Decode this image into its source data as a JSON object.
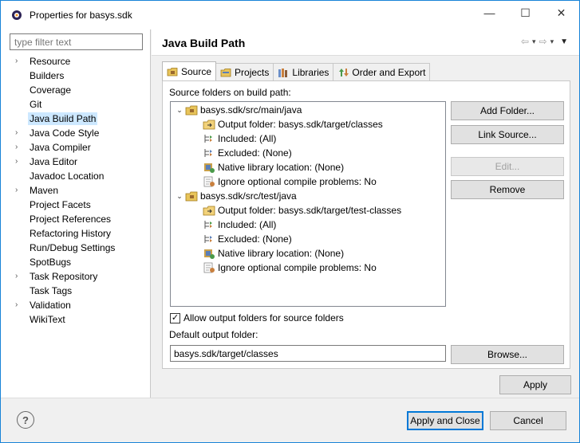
{
  "window": {
    "title": "Properties for basys.sdk",
    "minimize": "—",
    "maximize": "☐",
    "close": "✕"
  },
  "filter": {
    "placeholder": "type filter text",
    "value": ""
  },
  "nav": [
    {
      "label": "Resource",
      "expandable": true
    },
    {
      "label": "Builders",
      "expandable": false
    },
    {
      "label": "Coverage",
      "expandable": false
    },
    {
      "label": "Git",
      "expandable": false
    },
    {
      "label": "Java Build Path",
      "expandable": false,
      "selected": true
    },
    {
      "label": "Java Code Style",
      "expandable": true
    },
    {
      "label": "Java Compiler",
      "expandable": true
    },
    {
      "label": "Java Editor",
      "expandable": true
    },
    {
      "label": "Javadoc Location",
      "expandable": false
    },
    {
      "label": "Maven",
      "expandable": true
    },
    {
      "label": "Project Facets",
      "expandable": false
    },
    {
      "label": "Project References",
      "expandable": false
    },
    {
      "label": "Refactoring History",
      "expandable": false
    },
    {
      "label": "Run/Debug Settings",
      "expandable": false
    },
    {
      "label": "SpotBugs",
      "expandable": false
    },
    {
      "label": "Task Repository",
      "expandable": true
    },
    {
      "label": "Task Tags",
      "expandable": false
    },
    {
      "label": "Validation",
      "expandable": true
    },
    {
      "label": "WikiText",
      "expandable": false
    }
  ],
  "page": {
    "title": "Java Build Path"
  },
  "tabs": [
    {
      "label": "Source",
      "icon": "source-folder-icon",
      "active": true
    },
    {
      "label": "Projects",
      "icon": "projects-icon",
      "active": false
    },
    {
      "label": "Libraries",
      "icon": "libraries-icon",
      "active": false
    },
    {
      "label": "Order and Export",
      "icon": "order-export-icon",
      "active": false
    }
  ],
  "source": {
    "section_label": "Source folders on build path:",
    "folders": [
      {
        "name": "basys.sdk/src/main/java",
        "children": [
          {
            "label": "Output folder: basys.sdk/target/classes",
            "icon": "output-folder-icon"
          },
          {
            "label": "Included: (All)",
            "icon": "included-icon"
          },
          {
            "label": "Excluded: (None)",
            "icon": "excluded-icon"
          },
          {
            "label": "Native library location: (None)",
            "icon": "native-library-icon"
          },
          {
            "label": "Ignore optional compile problems: No",
            "icon": "ignore-problems-icon"
          }
        ]
      },
      {
        "name": "basys.sdk/src/test/java",
        "children": [
          {
            "label": "Output folder: basys.sdk/target/test-classes",
            "icon": "output-folder-icon"
          },
          {
            "label": "Included: (All)",
            "icon": "included-icon"
          },
          {
            "label": "Excluded: (None)",
            "icon": "excluded-icon"
          },
          {
            "label": "Native library location: (None)",
            "icon": "native-library-icon"
          },
          {
            "label": "Ignore optional compile problems: No",
            "icon": "ignore-problems-icon"
          }
        ]
      }
    ],
    "buttons": {
      "add_folder": "Add Folder...",
      "link_source": "Link Source...",
      "edit": "Edit...",
      "remove": "Remove"
    },
    "allow_output_label": "Allow output folders for source folders",
    "allow_output_checked": true,
    "default_output_label": "Default output folder:",
    "default_output_value": "basys.sdk/target/classes",
    "browse": "Browse..."
  },
  "apply": "Apply",
  "footer": {
    "help": "?",
    "apply_close": "Apply and Close",
    "cancel": "Cancel"
  },
  "colors": {
    "selection": "#cde8ff",
    "window_border": "#1883d7",
    "default_button_border": "#0078d7"
  }
}
